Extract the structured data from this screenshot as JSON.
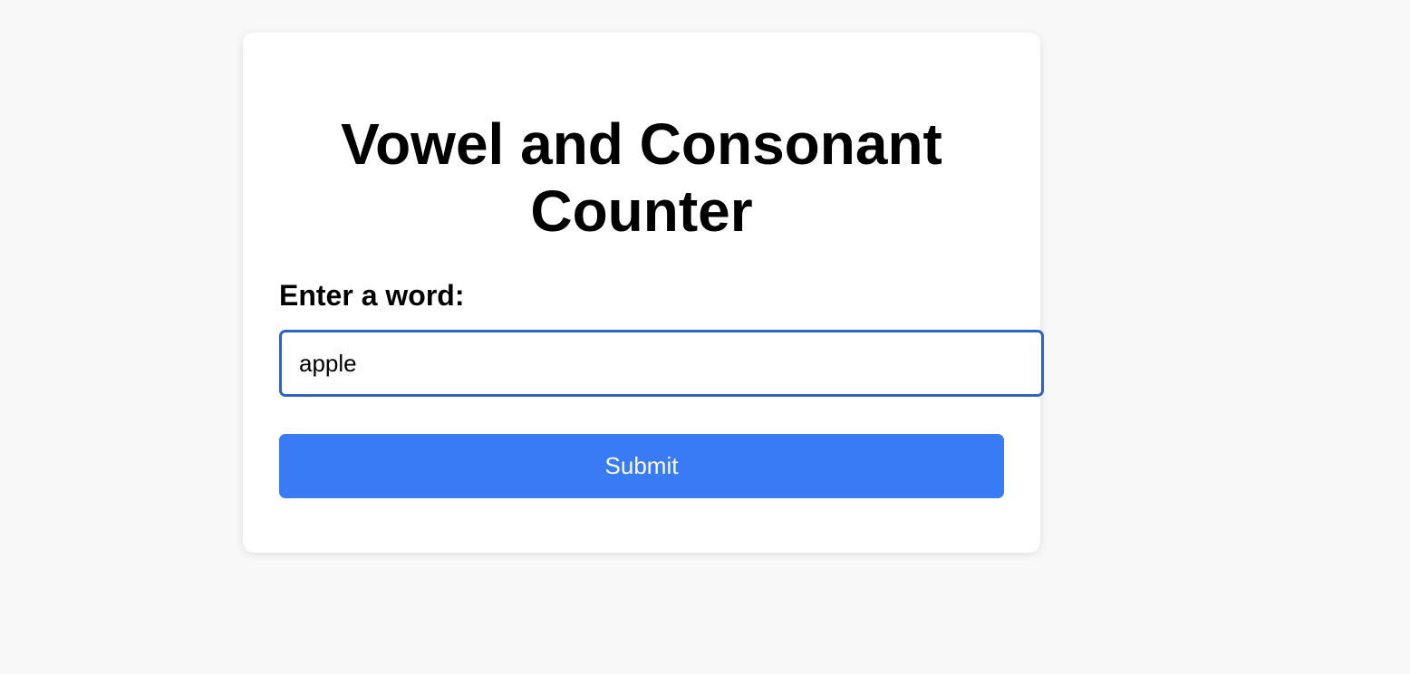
{
  "page": {
    "title": "Vowel and Consonant Counter"
  },
  "form": {
    "label": "Enter a word:",
    "input_value": "apple",
    "submit_label": "Submit"
  },
  "colors": {
    "background": "#f8f8f8",
    "card": "#ffffff",
    "input_border": "#2f63c4",
    "button": "#387bf5",
    "button_text": "#ffffff"
  }
}
